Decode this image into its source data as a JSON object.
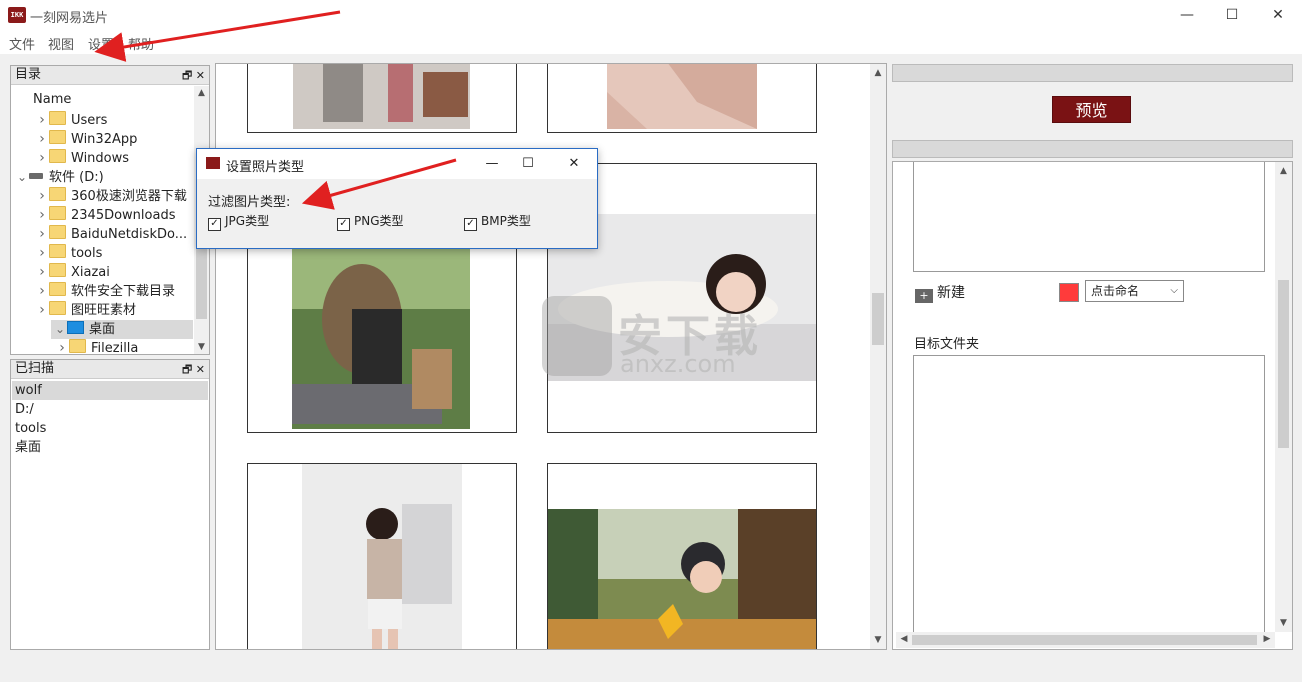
{
  "window": {
    "title": "一刻网易选片",
    "logo_text": "IKK",
    "minimize": "—",
    "maximize": "☐",
    "close": "✕"
  },
  "menu": [
    "文件",
    "视图",
    "设置",
    "帮助"
  ],
  "directory_panel": {
    "title": "目录",
    "column": "Name",
    "items": [
      {
        "label": "Users",
        "level": 1,
        "type": "folder",
        "expanded": false
      },
      {
        "label": "Win32App",
        "level": 1,
        "type": "folder",
        "expanded": false
      },
      {
        "label": "Windows",
        "level": 1,
        "type": "folder",
        "expanded": false
      },
      {
        "label": "软件 (D:)",
        "level": 0,
        "type": "drive",
        "expanded": true
      },
      {
        "label": "360极速浏览器下载",
        "level": 1,
        "type": "folder",
        "expanded": false
      },
      {
        "label": "2345Downloads",
        "level": 1,
        "type": "folder",
        "expanded": false
      },
      {
        "label": "BaiduNetdiskDo...",
        "level": 1,
        "type": "folder",
        "expanded": false
      },
      {
        "label": "tools",
        "level": 1,
        "type": "folder",
        "expanded": false
      },
      {
        "label": "Xiazai",
        "level": 1,
        "type": "folder",
        "expanded": false
      },
      {
        "label": "软件安全下载目录",
        "level": 1,
        "type": "folder",
        "expanded": false
      },
      {
        "label": "图旺旺素材",
        "level": 1,
        "type": "folder",
        "expanded": false
      },
      {
        "label": "桌面",
        "level": 1,
        "type": "desktop",
        "expanded": true
      },
      {
        "label": "Filezilla",
        "level": 2,
        "type": "folder",
        "expanded": false
      }
    ]
  },
  "scanned_panel": {
    "title": "已扫描",
    "items": [
      "wolf",
      "D:/",
      "tools",
      "桌面"
    ]
  },
  "dialog": {
    "title": "设置照片类型",
    "label": "过滤图片类型:",
    "options": [
      {
        "label": "JPG类型",
        "checked": true
      },
      {
        "label": "PNG类型",
        "checked": true
      },
      {
        "label": "BMP类型",
        "checked": true
      }
    ]
  },
  "right_panel": {
    "preview_label": "预览",
    "new_label": "新建",
    "color": "#ff3b3b",
    "name_select": "点击命名",
    "target_label": "目标文件夹"
  },
  "watermark": {
    "text": "安下载",
    "sub": "anxz.com"
  }
}
